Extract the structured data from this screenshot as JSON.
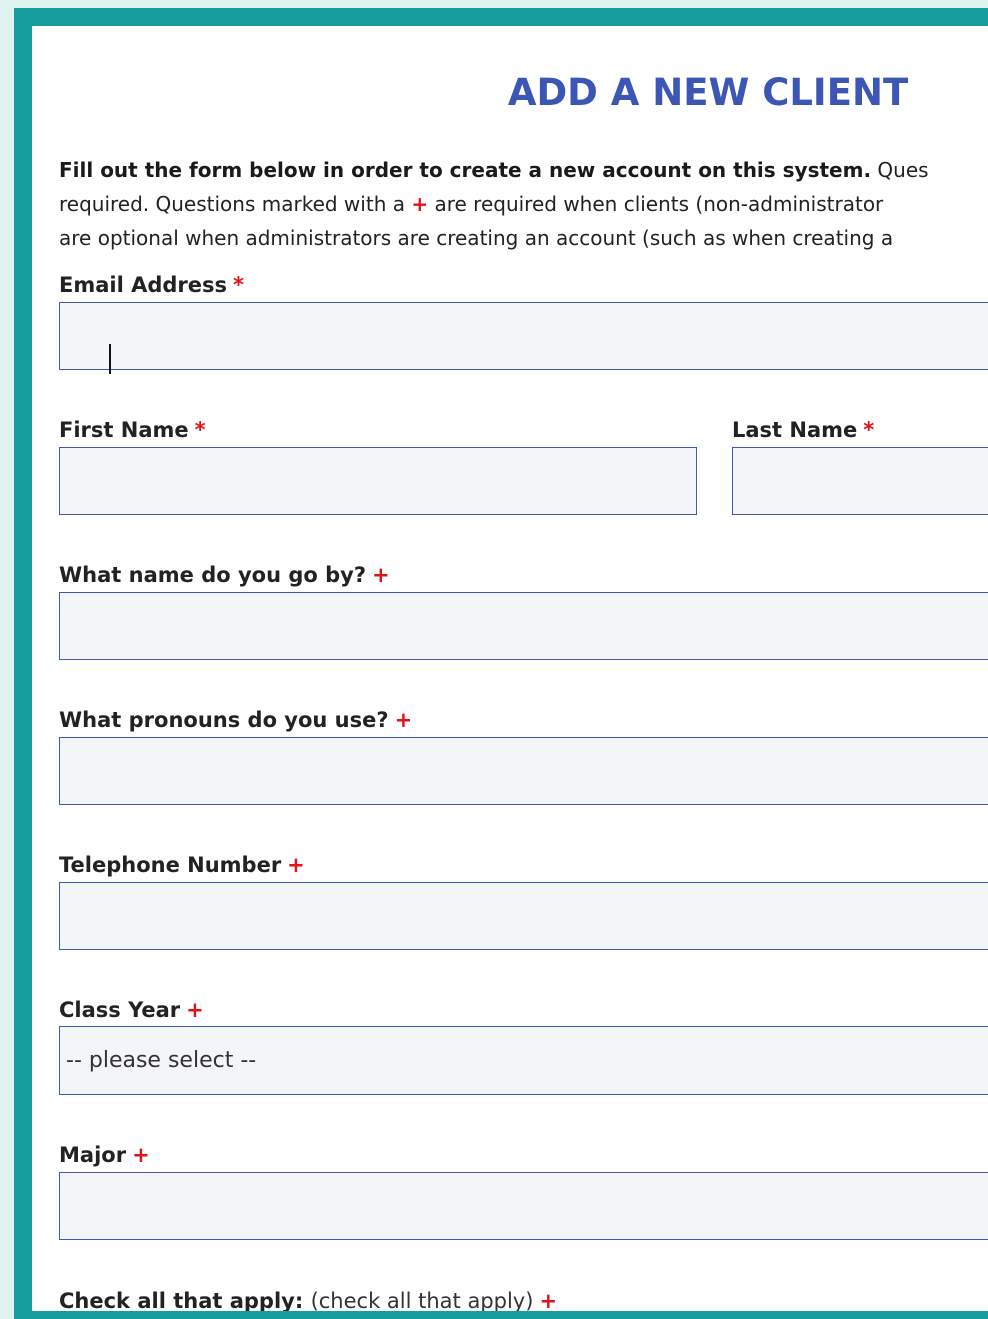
{
  "form": {
    "title": "ADD A NEW CLIENT",
    "intro_bold": "Fill out the form below in order to create a new account on this system.",
    "intro_line1_rest": " Ques",
    "intro_line2_a": "required. Questions marked with a ",
    "intro_line2_mark": "+",
    "intro_line2_b": " are required when clients (non-administrator",
    "intro_line3": "are optional when administrators are creating an account (such as when creating a",
    "required_mark": "*",
    "client_required_mark": "+"
  },
  "fields": {
    "email": {
      "label": "Email Address",
      "value": ""
    },
    "first_name": {
      "label": "First Name",
      "value": ""
    },
    "last_name": {
      "label": "Last Name",
      "value": ""
    },
    "preferred_name": {
      "label": "What name do you go by?",
      "value": ""
    },
    "pronouns": {
      "label": "What pronouns do you use?",
      "value": ""
    },
    "telephone": {
      "label": "Telephone Number",
      "value": ""
    },
    "class_year": {
      "label": "Class Year",
      "selected": "-- please select --"
    },
    "major": {
      "label": "Major",
      "value": ""
    },
    "check_all": {
      "label": "Check all that apply:",
      "sub": "(check all that apply)"
    }
  },
  "colors": {
    "frame": "#159e9b",
    "outer_background": "#dff3f1",
    "title": "#3b56b5",
    "input_border": "#3c5bb8",
    "input_fill": "#f4f5f8",
    "required_mark": "#e3111a"
  }
}
